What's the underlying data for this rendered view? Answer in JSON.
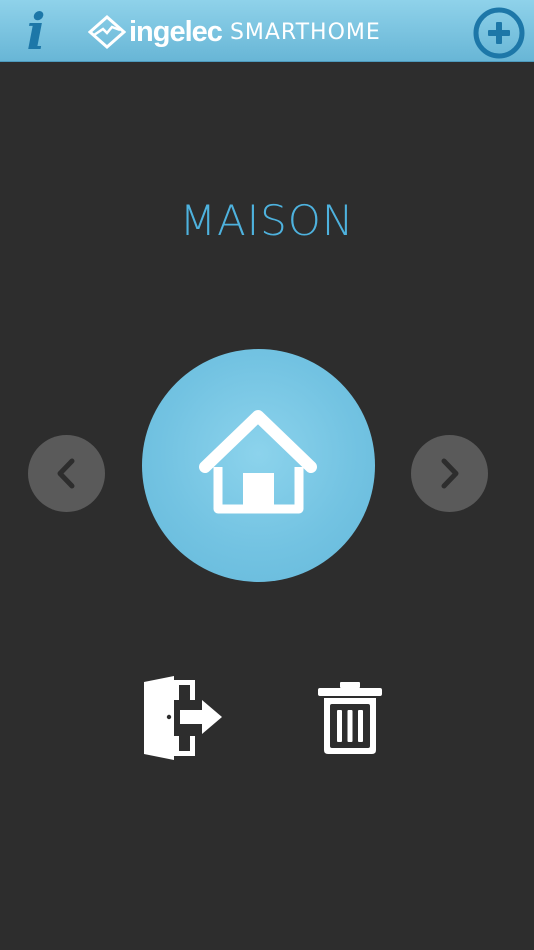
{
  "header": {
    "info_glyph": "i",
    "brand_name": "ingelec",
    "brand_sub": "SMARTHOME",
    "info_icon": "info-icon",
    "add_icon": "plus-circle-icon"
  },
  "room": {
    "name": "MAISON",
    "icon": "house-icon"
  },
  "navigation": {
    "prev_icon": "chevron-left-icon",
    "next_icon": "chevron-right-icon"
  },
  "actions": {
    "exit_icon": "exit-door-icon",
    "delete_icon": "trash-icon"
  },
  "colors": {
    "background": "#2d2d2d",
    "header": "#7cc4e1",
    "accent": "#4eb2de",
    "icon_blue": "#1d77a8",
    "nav_button": "#5a5a5a",
    "room_circle": "#73c3e2"
  }
}
